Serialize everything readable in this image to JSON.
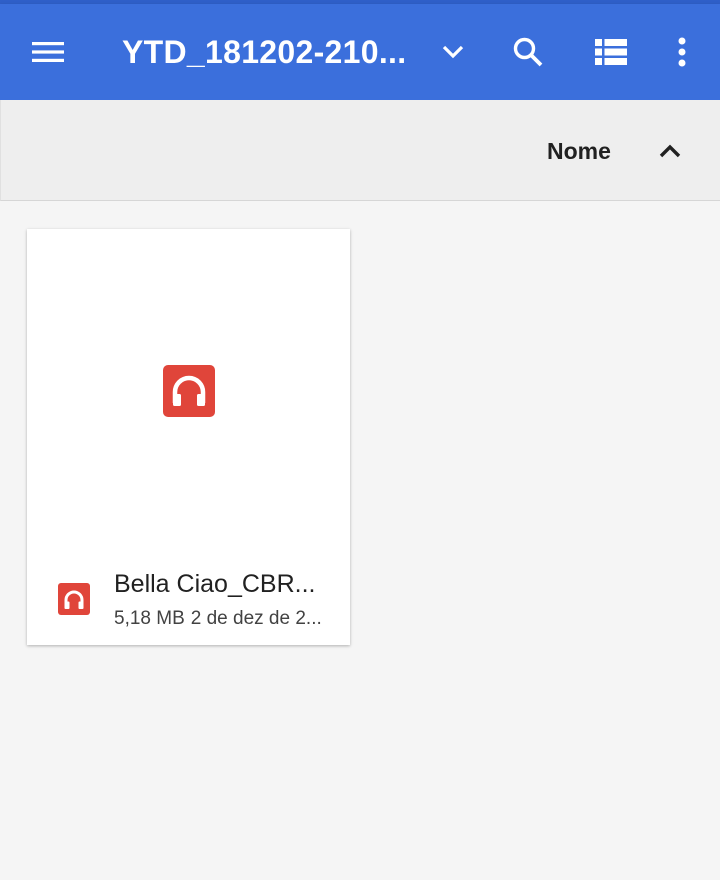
{
  "appbar": {
    "title": "YTD_181202-210...",
    "color": "#3b6fdc",
    "icons": [
      "menu-icon",
      "chevron-down-icon",
      "search-icon",
      "list-view-icon",
      "more-vert-icon"
    ]
  },
  "sortbar": {
    "label": "Nome",
    "direction_icon": "chevron-up-icon"
  },
  "files": [
    {
      "name": "Bella Ciao_CBR...",
      "size": "5,18 MB",
      "date": "2 de dez de 2...",
      "type_icon": "audio-headphones-icon",
      "icon_color": "#e0453a"
    }
  ]
}
